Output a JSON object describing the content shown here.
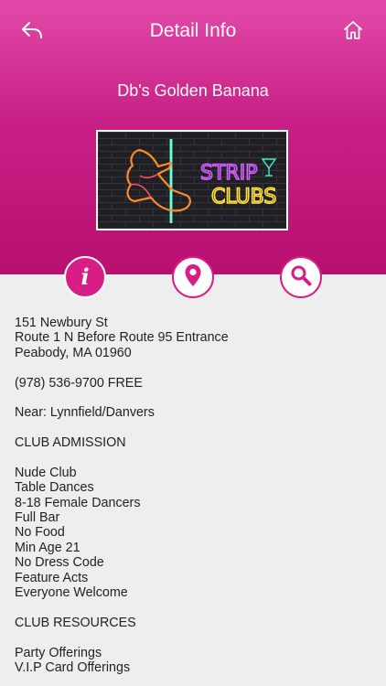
{
  "header": {
    "title": "Detail Info",
    "club_name": "Db's Golden Banana",
    "banner_sign": {
      "word1": "STRIP",
      "word2": "CLUBS"
    },
    "back_icon": "back-arrow-icon",
    "home_icon": "home-icon"
  },
  "tabs": [
    {
      "name": "info",
      "icon": "info-icon",
      "active": true
    },
    {
      "name": "map",
      "icon": "map-pin-icon",
      "active": false
    },
    {
      "name": "search",
      "icon": "search-icon",
      "active": false
    }
  ],
  "details": {
    "address": [
      "151 Newbury St",
      "Route 1 N Before Route 95 Entrance",
      "Peabody, MA 01960"
    ],
    "phone": "(978) 536-9700 FREE",
    "near": "Near: Lynnfield/Danvers",
    "admission_heading": "CLUB ADMISSION",
    "admission_items": [
      "Nude Club",
      "Table Dances",
      "8-18 Female Dancers",
      "Full Bar",
      "No Food",
      "Min Age 21",
      "No Dress Code",
      "Feature Acts",
      "Everyone Welcome"
    ],
    "resources_heading": "CLUB RESOURCES",
    "resources_items": [
      "Party Offerings",
      "V.I.P Card Offerings"
    ]
  },
  "colors": {
    "accent": "#d81e86",
    "header_top": "#e24aa8",
    "header_bottom": "#b8106f",
    "background": "#eeeeee"
  }
}
